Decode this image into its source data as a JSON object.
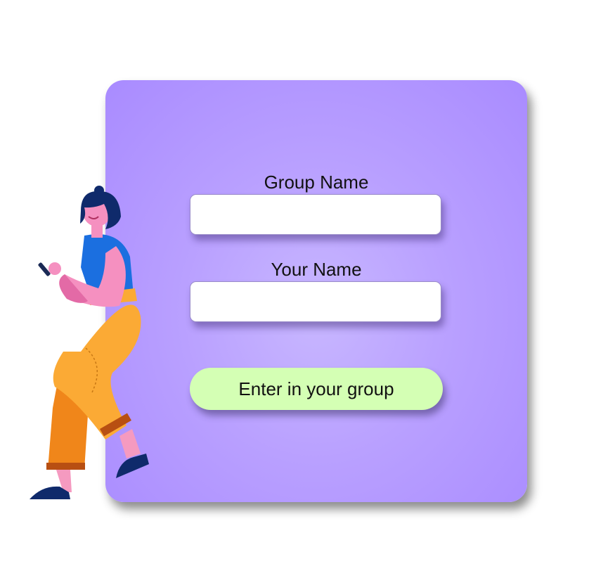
{
  "form": {
    "group_name_label": "Group Name",
    "group_name_value": "",
    "your_name_label": "Your Name",
    "your_name_value": "",
    "submit_label": "Enter in your group"
  },
  "illustration": {
    "icon": "woman-with-phone-illustration"
  },
  "colors": {
    "card_background": "#b9a0ff",
    "button_background": "#d4ffb4",
    "input_background": "#ffffff",
    "text": "#111111"
  }
}
